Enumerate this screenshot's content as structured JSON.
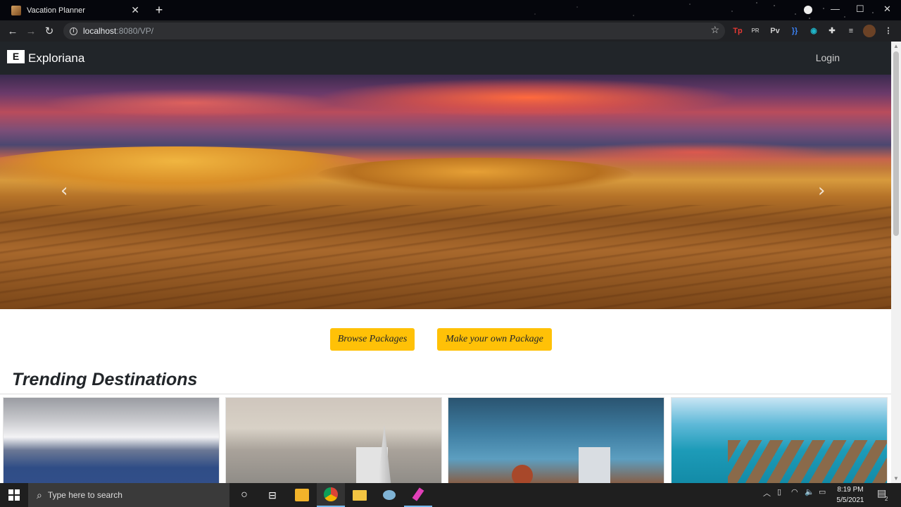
{
  "browser": {
    "tab_title": "Vacation Planner",
    "new_tab": "+",
    "close_tab": "✕",
    "url_host": "localhost",
    "url_rest": ":8080/VP/",
    "window_min": "—",
    "window_max": "☐",
    "window_close": "✕",
    "extensions": [
      "Tp",
      "PR",
      "Pv",
      "}}",
      "◉"
    ]
  },
  "site": {
    "brand_logo": "E",
    "brand_name": "Exploriana",
    "login": "Login",
    "carousel_prev": "‹",
    "carousel_next": "›",
    "buttons": {
      "browse": "Browse Packages",
      "custom": "Make your own Package"
    },
    "section_title": "Trending Destinations",
    "destinations": [
      {
        "icon": "snow-mountains-image"
      },
      {
        "icon": "burj-al-arab-city-image"
      },
      {
        "icon": "gateway-of-india-birds-image"
      },
      {
        "icon": "maldives-water-villas-image"
      }
    ]
  },
  "taskbar": {
    "search_placeholder": "Type here to search",
    "time": "8:19 PM",
    "date": "5/5/2021",
    "notification_count": "2"
  },
  "colors": {
    "accent_button": "#ffc107",
    "navbar": "#212529"
  }
}
